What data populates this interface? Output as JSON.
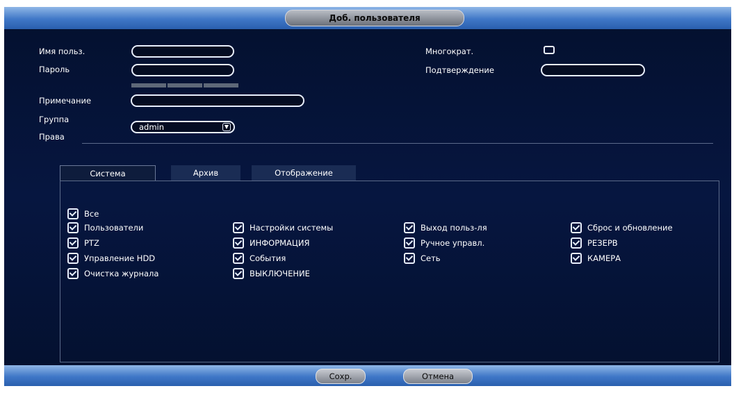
{
  "dialog": {
    "title": "Доб. пользователя"
  },
  "form": {
    "username_label": "Имя польз.",
    "password_label": "Пароль",
    "multi_label": "Многократ.",
    "confirm_label": "Подтверждение",
    "memo_label": "Примечание",
    "group_label": "Группа",
    "group_value": "admin",
    "rights_label": "Права"
  },
  "tabs": [
    {
      "label": "Система",
      "active": true
    },
    {
      "label": "Архив",
      "active": false
    },
    {
      "label": "Отображение",
      "active": false
    }
  ],
  "permissions": {
    "all": "Все",
    "col1": [
      "Пользователи",
      "PTZ",
      "Управление HDD",
      "Очистка журнала"
    ],
    "col2": [
      "Настройки системы",
      "ИНФОРМАЦИЯ",
      "События",
      "ВЫКЛЮЧЕНИЕ"
    ],
    "col3": [
      "Выход польз-ля",
      "Ручное управл.",
      "Сеть"
    ],
    "col4": [
      "Сброс и обновление",
      "РЕЗЕРВ",
      "КАМЕРА"
    ]
  },
  "buttons": {
    "save": "Сохр.",
    "cancel": "Отмена"
  },
  "colors": {
    "header": "#3f77c7",
    "background": "#061640",
    "accent": "#e8eefb"
  },
  "icons": {
    "checkbox": "checked-checkbox-icon",
    "dropdown": "chevron-down-icon"
  }
}
